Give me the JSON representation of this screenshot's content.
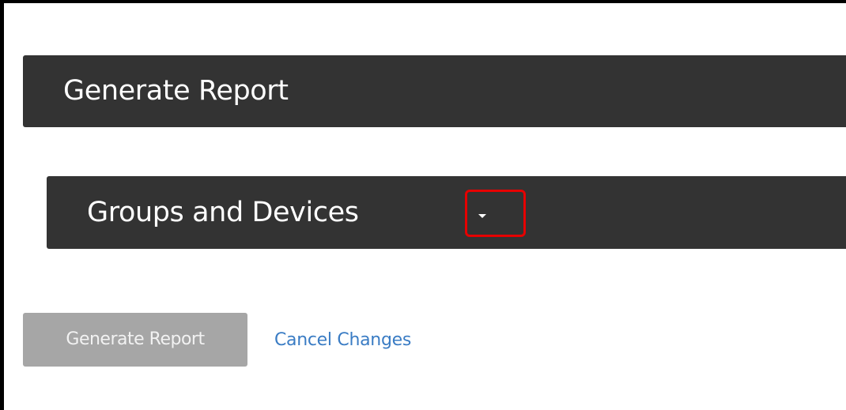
{
  "report_header": {
    "title": "Generate Report"
  },
  "groups_section": {
    "title": "Groups and Devices",
    "toggle_icon": "caret-down-icon",
    "highlight_color": "#e60000"
  },
  "actions": {
    "generate_label": "Generate Report",
    "generate_disabled": true,
    "cancel_label": "Cancel Changes"
  },
  "colors": {
    "header_bg": "#333333",
    "button_disabled_bg": "#a6a6a6",
    "link": "#3a7cc4"
  }
}
